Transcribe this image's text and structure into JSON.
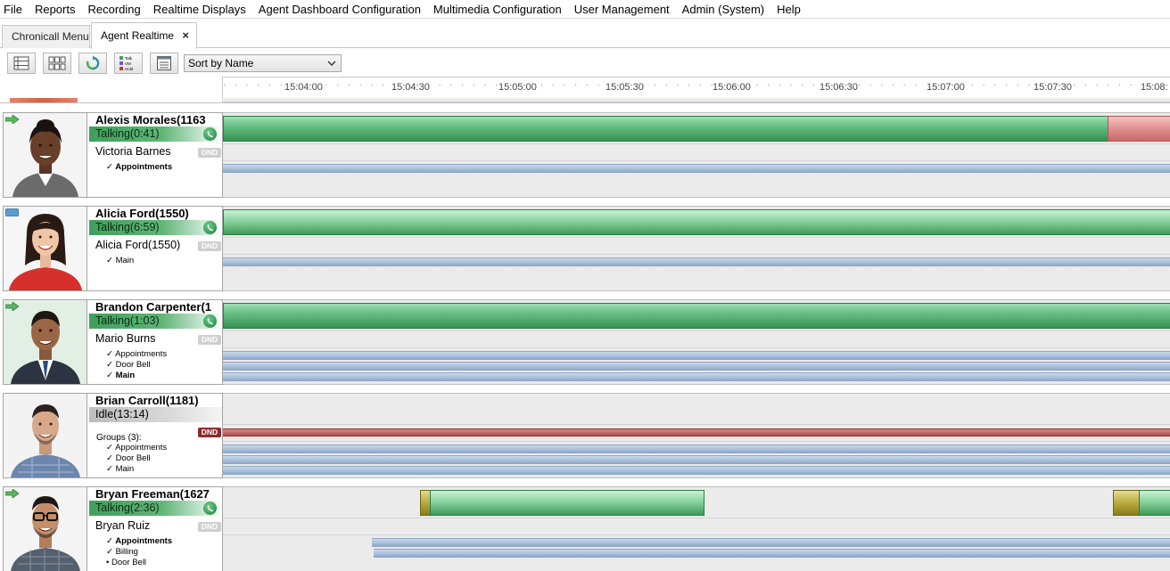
{
  "menu": [
    "File",
    "Reports",
    "Recording",
    "Realtime Displays",
    "Agent Dashboard Configuration",
    "Multimedia Configuration",
    "User Management",
    "Admin (System)",
    "Help"
  ],
  "tabs": [
    {
      "label": "Chronicall Menu",
      "active": false
    },
    {
      "label": "Agent Realtime",
      "active": true,
      "close": "×"
    }
  ],
  "toolbar": {
    "buttons": [
      "list-view-icon",
      "grid-view-icon",
      "refresh-icon",
      "talk-vm-hold-icon",
      "details-icon"
    ],
    "talk_vm_hold_labels": [
      "Talk",
      "VM",
      "Hold"
    ],
    "sort_value": "Sort by Name"
  },
  "timeline": {
    "ticks": [
      "15:04:00",
      "15:04:30",
      "15:05:00",
      "15:05:30",
      "15:06:00",
      "15:06:30",
      "15:07:00",
      "15:07:30",
      "15:08:"
    ]
  },
  "colors": {
    "talking": "#4caf6a",
    "idle": "#cfcfcf",
    "dnd_active": "#8c2b2b",
    "dnd_inactive": "#cfcfcf",
    "queue_bar": "#a9bfd9",
    "hold": "#b8aa3e",
    "wrap_up": "#e08f8f"
  },
  "agents": [
    {
      "name": "Alexis Morales(1163",
      "state": "talking",
      "state_icon": "arrow-in-icon",
      "status": "Talking(0:41)",
      "caller": "Victoria Barnes",
      "dnd": "DND",
      "dnd_active": false,
      "groups_label": "",
      "groups": [
        {
          "text": "✓ Appointments",
          "bold": true
        }
      ]
    },
    {
      "name": "Alicia Ford(1550)",
      "state": "talking",
      "state_icon": "monitor-icon",
      "status": "Talking(6:59)",
      "caller": "Alicia Ford(1550)",
      "dnd": "DND",
      "dnd_active": false,
      "groups_label": "",
      "groups": [
        {
          "text": "✓ Main",
          "bold": false
        }
      ]
    },
    {
      "name": "Brandon Carpenter(1",
      "state": "talking",
      "state_icon": "arrow-in-icon",
      "status": "Talking(1:03)",
      "caller": "Mario Burns",
      "dnd": "DND",
      "dnd_active": false,
      "groups_label": "",
      "groups": [
        {
          "text": "✓ Appointments",
          "bold": false
        },
        {
          "text": "✓ Door Bell",
          "bold": false
        },
        {
          "text": "✓ Main",
          "bold": true
        }
      ]
    },
    {
      "name": "Brian Carroll(1181)",
      "state": "idle",
      "state_icon": "",
      "status": "Idle(13:14)",
      "caller": "",
      "dnd": "DND",
      "dnd_active": true,
      "groups_label": "Groups (3):",
      "groups": [
        {
          "text": "✓ Appointments",
          "bold": false
        },
        {
          "text": "✓ Door Bell",
          "bold": false
        },
        {
          "text": "✓ Main",
          "bold": false
        }
      ]
    },
    {
      "name": "Bryan Freeman(1627",
      "state": "talking",
      "state_icon": "arrow-in-icon",
      "status": "Talking(2:36)",
      "caller": "Bryan Ruiz",
      "dnd": "DND",
      "dnd_active": false,
      "groups_label": "",
      "groups": [
        {
          "text": "✓ Appointments",
          "bold": true
        },
        {
          "text": "✓ Billing",
          "bold": false
        },
        {
          "text": "• Door Bell",
          "bold": false
        }
      ]
    }
  ]
}
